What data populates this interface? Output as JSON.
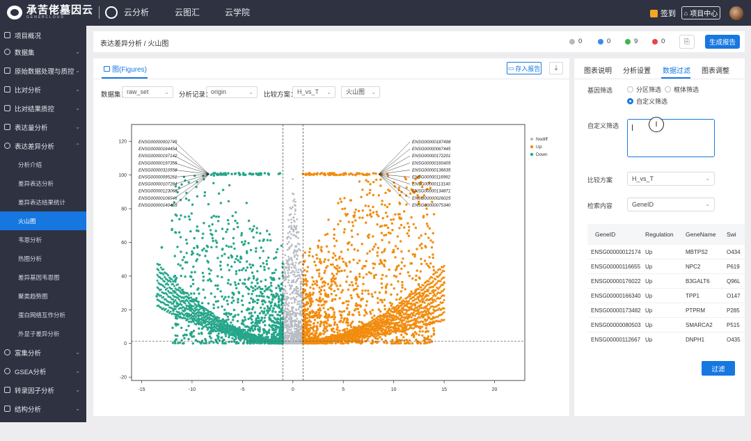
{
  "topbar": {
    "logo_text": "承苦佬墓因云",
    "logo_sub": "GENEBCLOUD",
    "nav": [
      "云分析",
      "云图汇",
      "云学院"
    ],
    "sign_label": "签到",
    "project_center": "项目中心"
  },
  "sidebar": {
    "items": [
      {
        "label": "项目概况",
        "icon": "grid-icon"
      },
      {
        "label": "数据集",
        "icon": "database-icon",
        "chevron": "⌄"
      },
      {
        "label": "原始数据处理与质控",
        "icon": "filter-icon",
        "chevron": "⌄"
      },
      {
        "label": "比对分析",
        "icon": "list-icon",
        "chevron": "⌄"
      },
      {
        "label": "比对结果质控",
        "icon": "chart-icon",
        "chevron": "⌄"
      },
      {
        "label": "表达量分析",
        "icon": "bar-icon",
        "chevron": "⌄"
      },
      {
        "label": "表达差异分析",
        "icon": "gear-icon",
        "chevron": "⌃"
      }
    ],
    "subitems": [
      "分析介绍",
      "差异表达分析",
      "差异表达结果统计",
      "火山图",
      "韦恩分析",
      "热图分析",
      "差异基因韦恩图",
      "聚类趋势图",
      "蛋白网络互作分析",
      "外显子差异分析"
    ],
    "bottom_items": [
      {
        "label": "富集分析",
        "icon": "target-icon",
        "chevron": "⌄"
      },
      {
        "label": "GSEA分析",
        "icon": "circle-icon",
        "chevron": "⌄"
      },
      {
        "label": "转录因子分析",
        "icon": "tag-icon",
        "chevron": "⌄"
      },
      {
        "label": "结构分析",
        "icon": "structure-icon",
        "chevron": "⌄"
      }
    ]
  },
  "breadcrumb": {
    "parent": "表达差异分析",
    "sep": "/",
    "current": "火山图"
  },
  "status": [
    {
      "count": "0",
      "color": "#b8b8be"
    },
    {
      "count": "0",
      "color": "#3b8be6"
    },
    {
      "count": "9",
      "color": "#3bb554"
    },
    {
      "count": "0",
      "color": "#e64545"
    }
  ],
  "gen_report": "生成报告",
  "figure_panel": {
    "tab_label": "图(Figures)",
    "save_label": "存入报告",
    "controls": {
      "dataset_label": "数据集：",
      "dataset_value": "raw_set",
      "record_label": "分析记录：",
      "record_value": "origin",
      "compare_label": "比较方案：",
      "compare_value": "H_vs_T",
      "plot_value": "火山图"
    }
  },
  "chart_data": {
    "type": "scatter",
    "title": "",
    "xlabel": "",
    "ylabel": "",
    "xlim": [
      -16,
      23
    ],
    "ylim": [
      -22,
      130
    ],
    "xticks": [
      -15,
      -10,
      -5,
      0,
      5,
      10,
      15,
      20
    ],
    "yticks": [
      -20,
      0,
      20,
      40,
      60,
      80,
      100,
      120
    ],
    "vlines": [
      -1,
      1
    ],
    "hline": 1.3,
    "grid": false,
    "legend_position": "top-right",
    "series": [
      {
        "name": "Nodiff",
        "color": "#b8bcc4"
      },
      {
        "name": "Up",
        "color": "#f28c0f"
      },
      {
        "name": "Down",
        "color": "#26a68a"
      }
    ],
    "labels_left": [
      "ENSG00000002745",
      "ENSG00000164454",
      "ENSG00000197142",
      "ENSG00000197355",
      "ENSG00000310558",
      "ENSG00000095261",
      "ENSG00000107284",
      "ENSG00000123068",
      "ENSG00000106546",
      "ENSG00000140463"
    ],
    "labels_right": [
      "ENSG00000187498",
      "ENSG00000067445",
      "ENSG00000172201",
      "ENSG00000160405",
      "ENSG00000136635",
      "ENSG00000116992",
      "ENSG00000113140",
      "ENSG00000134871",
      "ENSG00000026025",
      "ENSG00000075340"
    ]
  },
  "right_panel": {
    "tabs": [
      "图表说明",
      "分析设置",
      "数据过滤",
      "图表调整"
    ],
    "gene_filter_label": "基因筛选",
    "radio_options": [
      "分区筛选",
      "框体筛选",
      "自定义筛选"
    ],
    "custom_filter_label": "自定义筛选",
    "compare_label": "比较方案",
    "compare_value": "H_vs_T",
    "search_label": "检索内容",
    "search_value": "GeneID",
    "table": {
      "headers": [
        "GeneID",
        "Regulation",
        "GeneName",
        "Swi"
      ],
      "rows": [
        [
          "ENSG00000012174",
          "Up",
          "MBTPS2",
          "O434"
        ],
        [
          "ENSG00000116655",
          "Up",
          "NPC2",
          "P619"
        ],
        [
          "ENSG00000176022",
          "Up",
          "B3GALT6",
          "Q96L"
        ],
        [
          "ENSG00000166340",
          "Up",
          "TPP1",
          "O147"
        ],
        [
          "ENSG00000173482",
          "Up",
          "PTPRM",
          "P285"
        ],
        [
          "ENSG00000080503",
          "Up",
          "SMARCA2",
          "P515"
        ],
        [
          "ENSG00000112667",
          "Up",
          "DNPH1",
          "O435"
        ]
      ]
    },
    "filter_button": "过滤"
  }
}
